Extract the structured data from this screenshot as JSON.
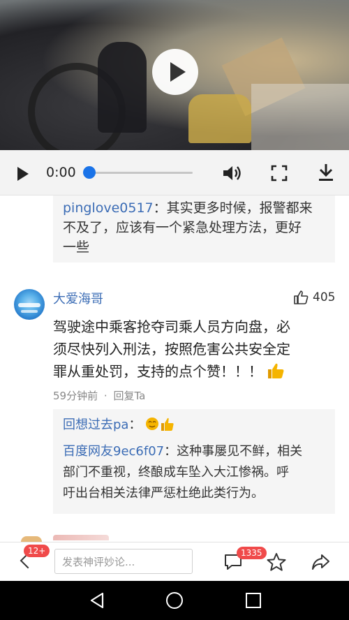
{
  "player": {
    "time": "0:00",
    "progress": 0
  },
  "reply_top": {
    "username": "pinglove0517",
    "text_line1": "：其实更多时候，报警都来",
    "text_line2": "不及了，应该有一个紧急处理方法，更好",
    "text_line3": "一些"
  },
  "comment": {
    "author": "大爱海哥",
    "likes": "405",
    "text_line1": "驾驶途中乘客抢夺司乘人员方向盘，必",
    "text_line2": "须尽快列入刑法，按照危害公共安全定",
    "text_line3": "罪从重处罚，支持的点个赞！！！",
    "time_ago": "59分钟前",
    "separator": "·",
    "reply_label": "回复Ta",
    "replies": [
      {
        "username": "回想过去pa",
        "text": "："
      },
      {
        "username": "百度网友9ec6f07",
        "text_line1": "：这种事屡见不鲜，相关",
        "text_line2": "部门不重视，终酿成车坠入大江惨祸。呼",
        "text_line3": "吁出台相关法律严惩杜绝此类行为。"
      }
    ]
  },
  "bottom": {
    "back_badge": "12+",
    "comment_placeholder": "发表神评妙论...",
    "comment_count_badge": "1335"
  },
  "colors": {
    "accent": "#1a73e8",
    "username": "#3b6cb5",
    "badge": "#f04a4a",
    "thumb_emoji": "#f5b400"
  }
}
